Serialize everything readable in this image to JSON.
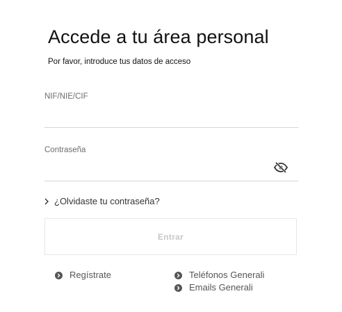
{
  "login": {
    "title": "Accede a tu área personal",
    "subtitle": "Por favor, introduce tus datos de acceso",
    "id_field": {
      "label": "NIF/NIE/CIF",
      "value": "",
      "placeholder": ""
    },
    "password_field": {
      "label": "Contraseña",
      "value": "",
      "placeholder": "",
      "toggle_icon": "eye-slash-icon"
    },
    "forgot_link": "¿Olvidaste tu contraseña?",
    "submit_label": "Entrar",
    "links": {
      "register": "Regístrate",
      "phones": "Teléfonos Generali",
      "emails": "Emails Generali"
    }
  },
  "colors": {
    "text": "#111111",
    "muted": "#6d6d6d",
    "line": "#d5d5d5",
    "button_border": "#e6e6e6",
    "button_text_disabled": "#c7c7c7",
    "bullet": "#555555"
  }
}
